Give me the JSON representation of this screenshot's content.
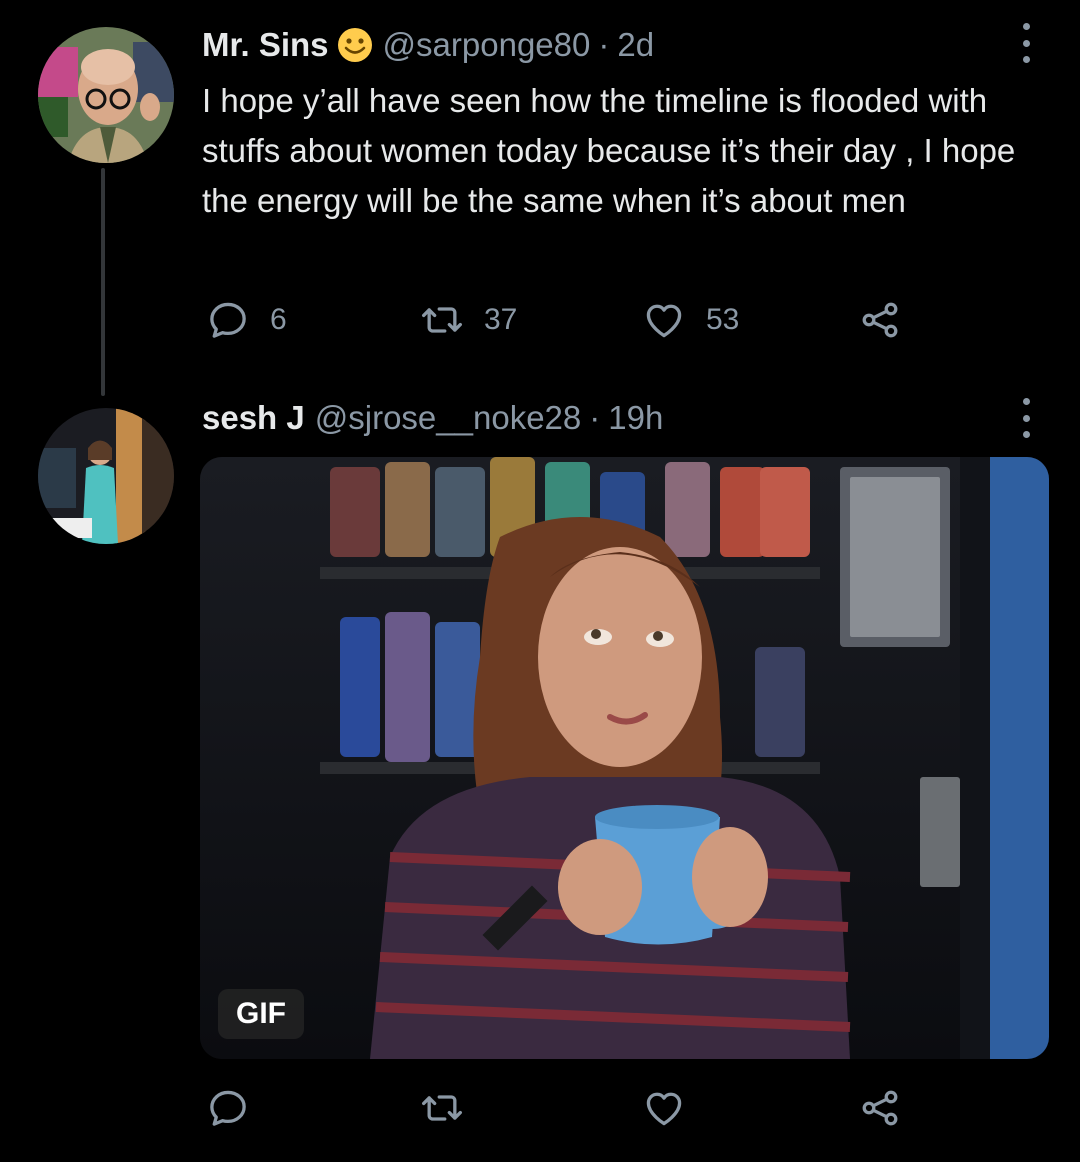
{
  "tweets": [
    {
      "display_name": "Mr. Sins",
      "handle": "@sarponge80",
      "separator": "·",
      "time": "2d",
      "text": "I hope y’all have seen how the timeline is flooded with stuffs about women today because it’s their day , I hope the energy will be the same when it’s about men",
      "reply_count": "6",
      "retweet_count": "37",
      "like_count": "53"
    },
    {
      "display_name": "sesh J",
      "handle": "@sjrose__noke28",
      "separator": "·",
      "time": "19h",
      "media_badge": "GIF"
    }
  ],
  "icons": {
    "reply": "reply-icon",
    "retweet": "retweet-icon",
    "like": "heart-icon",
    "share": "share-icon",
    "more": "more-options-icon",
    "emoji": "smiley-emoji"
  },
  "colors": {
    "background": "#000000",
    "primary_text": "#e7e9ea",
    "secondary_text": "#8b98a5",
    "thread_line": "#333639",
    "mug": "#5b9fd6"
  }
}
